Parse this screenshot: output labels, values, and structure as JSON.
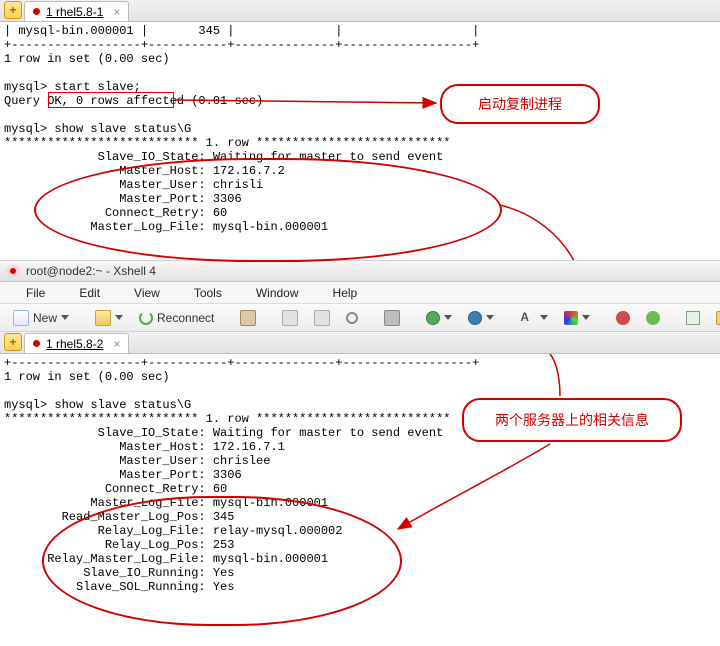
{
  "pane1": {
    "tab": {
      "label": "1 rhel5.8-1"
    },
    "addLabel": "+",
    "closeLabel": "×",
    "terminal": "| mysql-bin.000001 |       345 |              |                  |\n+------------------+-----------+--------------+------------------+\n1 row in set (0.00 sec)\n\nmysql> start slave;\nQuery OK, 0 rows affected (0.01 sec)\n\nmysql> show slave status\\G\n*************************** 1. row ***************************\n             Slave_IO_State: Waiting for master to send event\n                Master_Host: 172.16.7.2\n                Master_User: chrisli\n                Master_Port: 3306\n              Connect_Retry: 60\n            Master_Log_File: mysql-bin.000001"
  },
  "win2": {
    "title": "root@node2:~ - Xshell 4",
    "menu": {
      "file": "File",
      "edit": "Edit",
      "view": "View",
      "tools": "Tools",
      "window": "Window",
      "help": "Help"
    },
    "toolbar": {
      "new": "New",
      "reconnect": "Reconnect"
    },
    "tab": {
      "label": "1 rhel5.8-2"
    },
    "addLabel": "+",
    "closeLabel": "×",
    "terminal": "+------------------+-----------+--------------+------------------+\n1 row in set (0.00 sec)\n\nmysql> show slave status\\G\n*************************** 1. row ***************************\n             Slave_IO_State: Waiting for master to send event\n                Master_Host: 172.16.7.1\n                Master_User: chrislee\n                Master_Port: 3306\n              Connect_Retry: 60\n            Master_Log_File: mysql-bin.000001\n        Read_Master_Log_Pos: 345\n             Relay_Log_File: relay-mysql.000002\n              Relay_Log_Pos: 253\n      Relay_Master_Log_File: mysql-bin.000001\n           Slave_IO_Running: Yes\n          Slave_SOL_Running: Yes"
  },
  "annotations": {
    "callout1": "启动复制进程",
    "callout2": "两个服务器上的相关信息"
  }
}
